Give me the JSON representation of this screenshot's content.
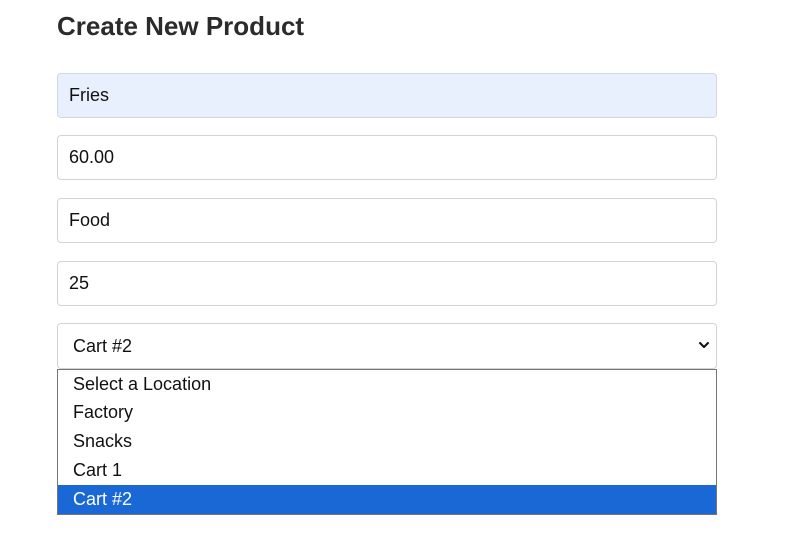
{
  "page": {
    "title": "Create New Product"
  },
  "form": {
    "name_value": "Fries",
    "price_value": "60.00",
    "category_value": "Food",
    "quantity_value": "25",
    "location": {
      "selected": "Cart #2",
      "options": [
        "Select a Location",
        "Factory",
        "Snacks",
        "Cart 1",
        "Cart #2"
      ]
    }
  },
  "colors": {
    "autofill_background": "#e8f0fe",
    "selected_option_background": "#1a68d6"
  },
  "icons": {
    "select_arrow": "chevron-down-icon"
  }
}
